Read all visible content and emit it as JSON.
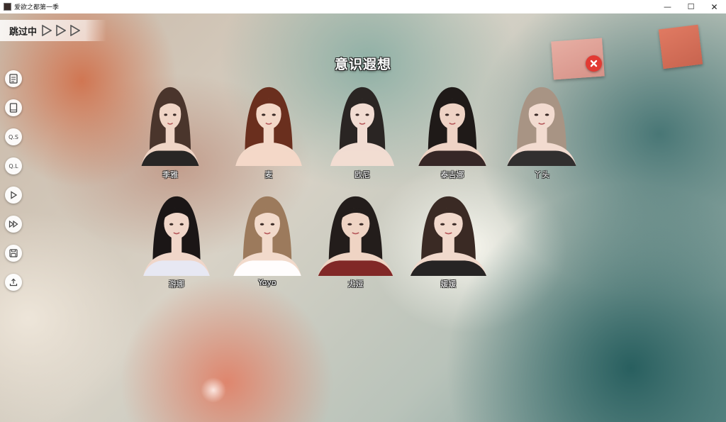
{
  "window": {
    "title": "爱欲之都第一季",
    "minimize": "—",
    "maximize": "☐",
    "close": "✕"
  },
  "skip": {
    "label": "跳过中"
  },
  "toolbar": {
    "qs_label": "Q.S",
    "ql_label": "Q.L"
  },
  "title": "意识遐想",
  "colors": {
    "close_button": "#e23a33",
    "note_big": "#e0a095",
    "note_small": "#d36d57"
  },
  "characters": [
    {
      "name": "季雅",
      "hair": "#4a352c",
      "skin": "#f0d5c6",
      "cloth": "#1c1c1c"
    },
    {
      "name": "麦",
      "hair": "#6a2f1e",
      "skin": "#f3d8c8",
      "cloth": "#f3d8c8"
    },
    {
      "name": "欧尼",
      "hair": "#2a2523",
      "skin": "#f1dcd2",
      "cloth": "#f1dcd2"
    },
    {
      "name": "泰吉娜",
      "hair": "#1f1a18",
      "skin": "#eed3c5",
      "cloth": "#2b1e1e"
    },
    {
      "name": "丫头",
      "hair": "#a89484",
      "skin": "#f2dbd0",
      "cloth": "#262626"
    },
    {
      "name": "游娜",
      "hair": "#1b1616",
      "skin": "#f0d6c9",
      "cloth": "#e6e9f5"
    },
    {
      "name": "Yoyo",
      "hair": "#9c7a5c",
      "skin": "#f2dacb",
      "cloth": "#ffffff"
    },
    {
      "name": "尤娅",
      "hair": "#231d1b",
      "skin": "#efd4c4",
      "cloth": "#7a1f1f"
    },
    {
      "name": "媛媛",
      "hair": "#3a2a24",
      "skin": "#f1d9cc",
      "cloth": "#1a1a1a"
    }
  ]
}
